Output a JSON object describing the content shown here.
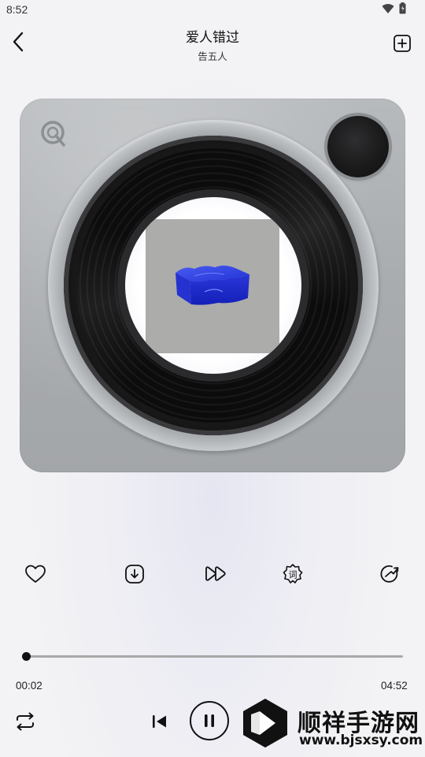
{
  "status_bar": {
    "time": "8:52",
    "icons": [
      "wifi-icon",
      "battery-icon"
    ]
  },
  "header": {
    "title": "爱人错过",
    "artist": "告五人",
    "icons": {
      "back": "chevron-left-icon",
      "add": "add-to-playlist-icon"
    }
  },
  "player": {
    "knob_icon": "power-knob",
    "logo_icon": "app-logo-icon"
  },
  "actions": [
    {
      "name": "like-button",
      "icon": "heart-icon"
    },
    {
      "name": "download-button",
      "icon": "download-icon"
    },
    {
      "name": "speed-button",
      "icon": "fast-forward-icon"
    },
    {
      "name": "lyrics-button",
      "icon": "lyrics-icon",
      "glyph": "词"
    },
    {
      "name": "share-button",
      "icon": "share-icon"
    }
  ],
  "progress": {
    "current": "00:02",
    "total": "04:52",
    "fraction": 0.007
  },
  "controls": {
    "repeat_icon": "repeat-icon",
    "prev_icon": "skip-previous-icon",
    "play_state_icon": "pause-icon"
  },
  "watermark": {
    "text": "顺祥手游网",
    "url": "www.bjsxsy.com"
  },
  "colors": {
    "accent": "#111111",
    "device": "#a9acaf",
    "album_bg": "#acacab"
  }
}
